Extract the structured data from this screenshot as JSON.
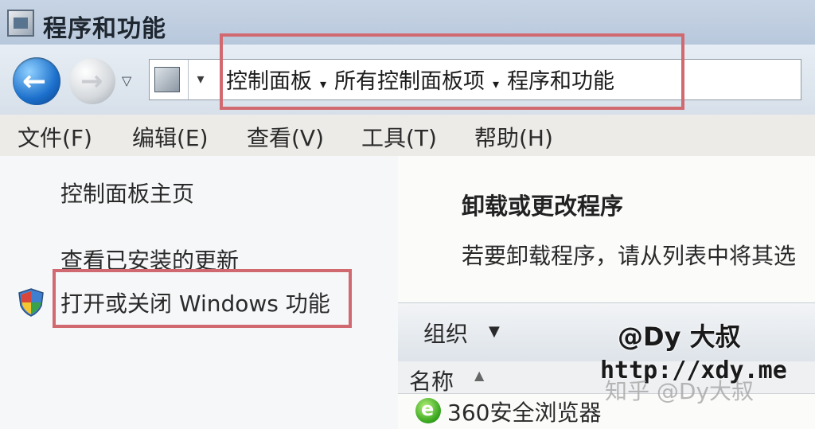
{
  "window": {
    "title": "程序和功能",
    "icon": "control-panel-icon"
  },
  "navigation": {
    "back_icon": "back-arrow-icon",
    "back_glyph": "←",
    "forward_icon": "forward-arrow-icon",
    "forward_glyph": "→",
    "history_dropdown_glyph": "▽",
    "address_dropdown_glyph": "▾",
    "breadcrumbs": [
      "控制面板",
      "所有控制面板项",
      "程序和功能"
    ],
    "breadcrumb_separator": "▸"
  },
  "menu": [
    {
      "label": "文件(F)"
    },
    {
      "label": "编辑(E)"
    },
    {
      "label": "查看(V)"
    },
    {
      "label": "工具(T)"
    },
    {
      "label": "帮助(H)"
    }
  ],
  "sidebar": {
    "links": [
      {
        "label": "控制面板主页"
      },
      {
        "label": "查看已安装的更新"
      },
      {
        "label": "打开或关闭 Windows 功能",
        "icon": "shield-icon"
      }
    ]
  },
  "main": {
    "heading": "卸载或更改程序",
    "description": "若要卸载程序，请从列表中将其选",
    "toolbar": {
      "organize_label": "组织",
      "organize_dropdown_glyph": "▼"
    },
    "columns": [
      {
        "label": "名称",
        "sort_glyph": "▲"
      }
    ],
    "rows": [
      {
        "name": "360安全浏览器",
        "icon": "browser-360-icon",
        "icon_glyph": "e"
      }
    ]
  },
  "watermarks": {
    "author": "@Dy 大叔",
    "url": "http://xdy.me",
    "platform": "知乎 @Dy大叔"
  },
  "colors": {
    "highlight": "#d16970",
    "titlebar": "#c7d4e4",
    "back_button": "#1b6fcb"
  }
}
